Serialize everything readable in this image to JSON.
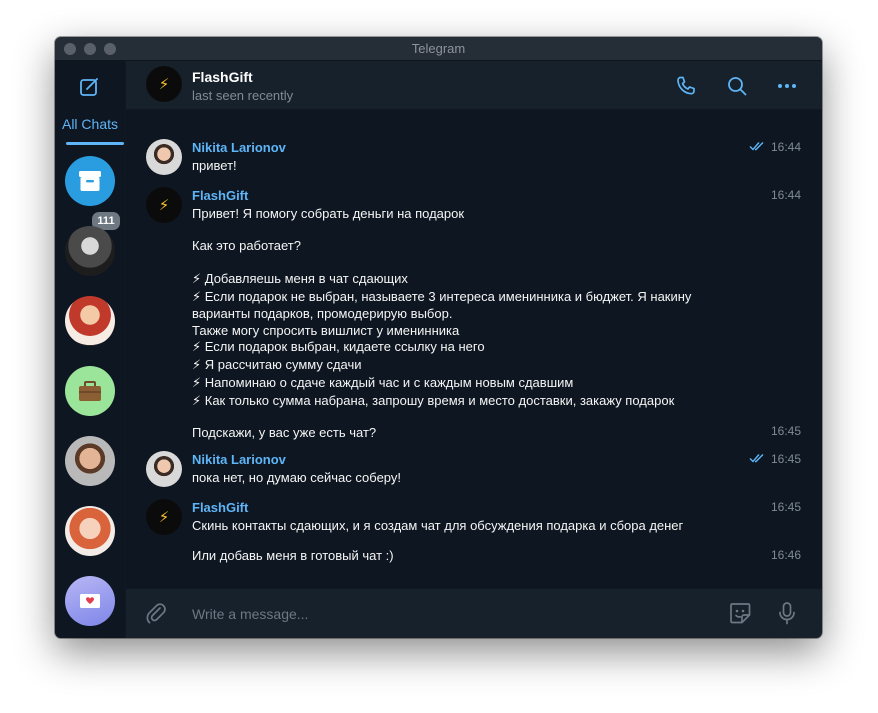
{
  "window": {
    "title": "Telegram"
  },
  "sidebar": {
    "folder": "All Chats",
    "archive_count": "111"
  },
  "header": {
    "name": "FlashGift",
    "status": "last seen recently"
  },
  "messages": [
    {
      "author": "Nikita Larionov",
      "text": "привет!",
      "time": "16:44"
    },
    {
      "author": "FlashGift",
      "text": "Привет! Я помогу собрать деньги на подарок",
      "time": "16:44"
    },
    {
      "text": "Как это работает?"
    },
    {
      "text": "⚡ Добавляешь меня в чат сдающих"
    },
    {
      "text": "⚡ Если подарок не выбран, называете 3 интереса именинника и бюджет. Я накину"
    },
    {
      "text": "варианты подарков, промодерирую выбор."
    },
    {
      "text": "Также могу спросить вишлист у именинника"
    },
    {
      "text": "⚡ Если подарок выбран, кидаете ссылку на него"
    },
    {
      "text": "⚡ Я рассчитаю сумму сдачи"
    },
    {
      "text": "⚡ Напоминаю о сдаче каждый час и с каждым новым сдавшим"
    },
    {
      "text": "⚡ Как только сумма набрана, запрошу время и место доставки, закажу подарок"
    },
    {
      "text": "Подскажи, у вас уже есть чат?",
      "time": "16:45"
    },
    {
      "author": "Nikita Larionov",
      "text": "пока нет, но думаю сейчас соберу!",
      "time": "16:45"
    },
    {
      "author": "FlashGift",
      "text": "Скинь контакты сдающих, и я создам чат для обсуждения подарка и сбора денег",
      "time": "16:45"
    },
    {
      "text": "Или добавь меня в готовый чат :)",
      "time": "16:46"
    }
  ],
  "composer": {
    "placeholder": "Write a message..."
  },
  "colors": {
    "accent": "#5eb5f7",
    "bg": "#0e1621",
    "panel": "#17212b"
  },
  "icons": [
    "compose-icon",
    "phone-icon",
    "search-icon",
    "more-icon",
    "attach-icon",
    "sticker-icon",
    "mic-icon",
    "archive-icon",
    "bolt-icon",
    "read-ticks-icon"
  ]
}
